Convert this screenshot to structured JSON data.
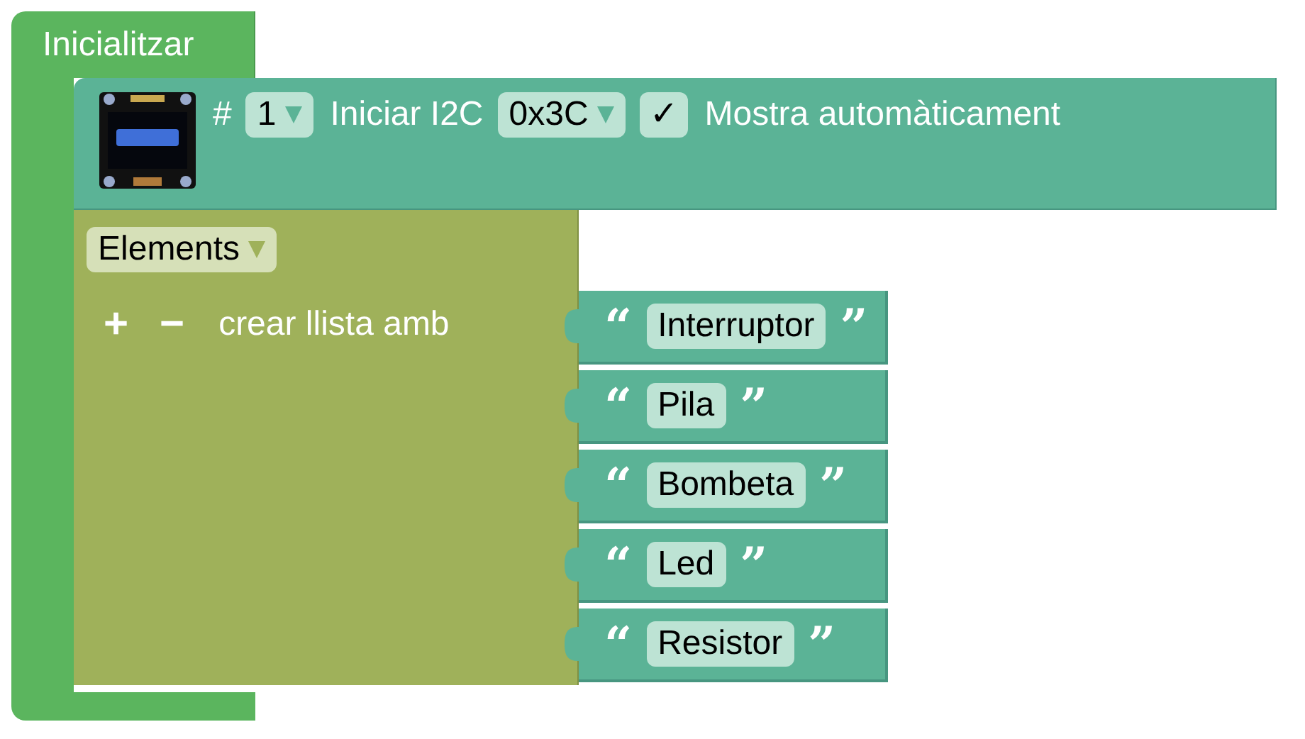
{
  "init_block": {
    "title": "Inicialitzar"
  },
  "oled_block": {
    "hash": "#",
    "display_number": {
      "value": "1"
    },
    "label": "Iniciar I2C",
    "address": {
      "value": "0x3C"
    },
    "auto_display": {
      "mark": "✓",
      "checked": true,
      "label": "Mostra automàticament"
    }
  },
  "list_block": {
    "variable": {
      "value": "Elements"
    },
    "add": "+",
    "remove": "−",
    "label": "crear llista amb",
    "items": [
      {
        "open_quote": "“",
        "text": "Interruptor",
        "close_quote": "”"
      },
      {
        "open_quote": "“",
        "text": "Pila",
        "close_quote": "”"
      },
      {
        "open_quote": "“",
        "text": "Bombeta",
        "close_quote": "”"
      },
      {
        "open_quote": "“",
        "text": "Led",
        "close_quote": "”"
      },
      {
        "open_quote": "“",
        "text": "Resistor",
        "close_quote": "”"
      }
    ]
  }
}
